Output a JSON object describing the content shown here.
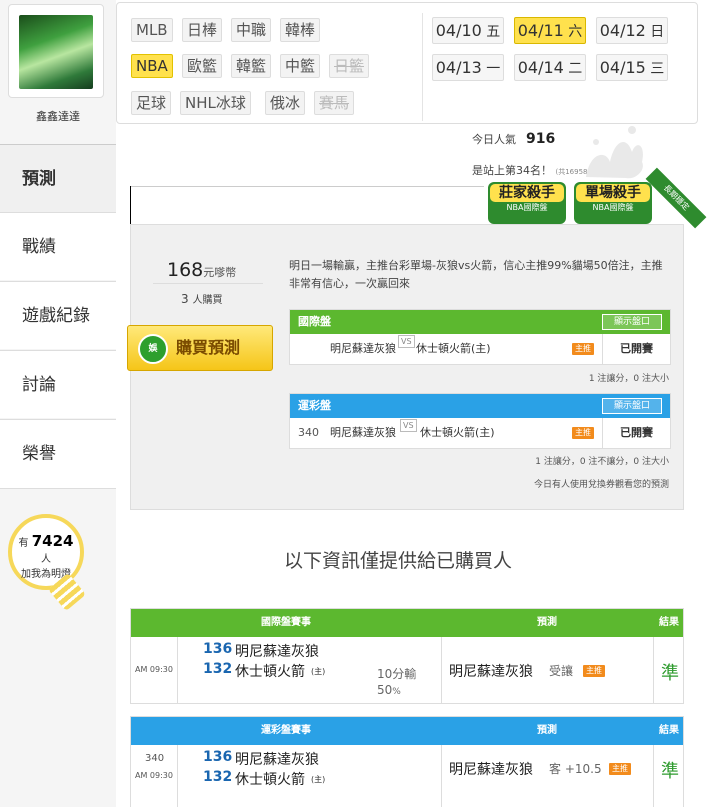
{
  "user": {
    "name": "鑫鑫達達"
  },
  "nav": [
    {
      "label": "預測",
      "active": true
    },
    {
      "label": "戰績"
    },
    {
      "label": "遊戲紀錄"
    },
    {
      "label": "討論"
    },
    {
      "label": "榮譽"
    }
  ],
  "lights": {
    "prefix": "有",
    "count": "7424",
    "suffix": "人",
    "action": "加我為明燈"
  },
  "leagues": [
    {
      "label": "MLB"
    },
    {
      "label": "日棒"
    },
    {
      "label": "中職"
    },
    {
      "label": "韓棒"
    },
    {
      "label": "NBA",
      "selected": true
    },
    {
      "label": "歐籃"
    },
    {
      "label": "韓籃"
    },
    {
      "label": "中籃"
    },
    {
      "label": "日籃",
      "disabled": true
    },
    {
      "label": "足球"
    },
    {
      "label": "NHL冰球"
    },
    {
      "label": "俄冰"
    },
    {
      "label": "賽馬",
      "disabled": true
    }
  ],
  "dates": [
    {
      "date": "04/10",
      "day": "五"
    },
    {
      "date": "04/11",
      "day": "六",
      "selected": true
    },
    {
      "date": "04/12",
      "day": "日"
    },
    {
      "date": "04/13",
      "day": "一"
    },
    {
      "date": "04/14",
      "day": "二"
    },
    {
      "date": "04/15",
      "day": "三"
    }
  ],
  "stats": {
    "popularity_label": "今日人氣",
    "popularity": "916",
    "rank_text": "是站上第34名！",
    "rank_note": "(共16958人)"
  },
  "badges": [
    {
      "title": "莊家殺手",
      "sub": "NBA國際盤"
    },
    {
      "title": "單場殺手",
      "sub": "NBA國際盤"
    }
  ],
  "ribbon": "長期穩定",
  "offer": {
    "price": "168",
    "price_unit": "元嗲幣",
    "buyers": "3",
    "buyers_unit": "人購買",
    "buy_label": "購買預測",
    "buy_icon": "娛",
    "description": "明日一場輸贏，主推台彩單場-灰狼vs火箭，信心主推99%貓場50倍注，主推非常有信心，一次贏回來"
  },
  "intl": {
    "title": "國際盤",
    "show_label": "顯示盤口",
    "away": "明尼蘇達灰狼",
    "vs": "VS",
    "home": "休士頓火箭(主)",
    "tag": "主推",
    "status": "已開賽",
    "rule": "1 注讓分，0 注大小"
  },
  "sports": {
    "title": "運彩盤",
    "show_label": "顯示盤口",
    "code": "340",
    "away": "明尼蘇達灰狼",
    "vs": "VS",
    "home": "休士頓火箭(主)",
    "tag": "主推",
    "status": "已開賽",
    "rule": "1 注讓分，0 注不讓分，0 注大小",
    "coupon_note": "今日有人使用兌換券觀看您的預測"
  },
  "notice": "以下資訊僅提供給已購買人",
  "results": [
    {
      "header_event": "國際盤賽事",
      "header_pred": "預測",
      "header_result": "結果",
      "code": "",
      "time": "AM 09:30",
      "away_num": "136",
      "away": "明尼蘇達灰狼",
      "home_num": "132",
      "home": "休士頓火箭",
      "home_mark": "(主)",
      "line1": "10分輸",
      "line2": "50",
      "line2_unit": "%",
      "pick": "明尼蘇達灰狼",
      "pick_detail": "受讓",
      "tag": "主推",
      "result": "準"
    },
    {
      "header_event": "運彩盤賽事",
      "header_pred": "預測",
      "header_result": "結果",
      "code": "340",
      "time": "AM 09:30",
      "away_num": "136",
      "away": "明尼蘇達灰狼",
      "home_num": "132",
      "home": "休士頓火箭",
      "home_mark": "(主)",
      "line1": "",
      "line2": "",
      "line2_unit": "",
      "pick": "明尼蘇達灰狼",
      "pick_detail": "客 +10.5",
      "tag": "主推",
      "result": "準"
    }
  ],
  "colors": {
    "accent": "#ffe14d",
    "green": "#5cb82f",
    "blue": "#2aa1e6",
    "tag": "#f28b1c"
  }
}
